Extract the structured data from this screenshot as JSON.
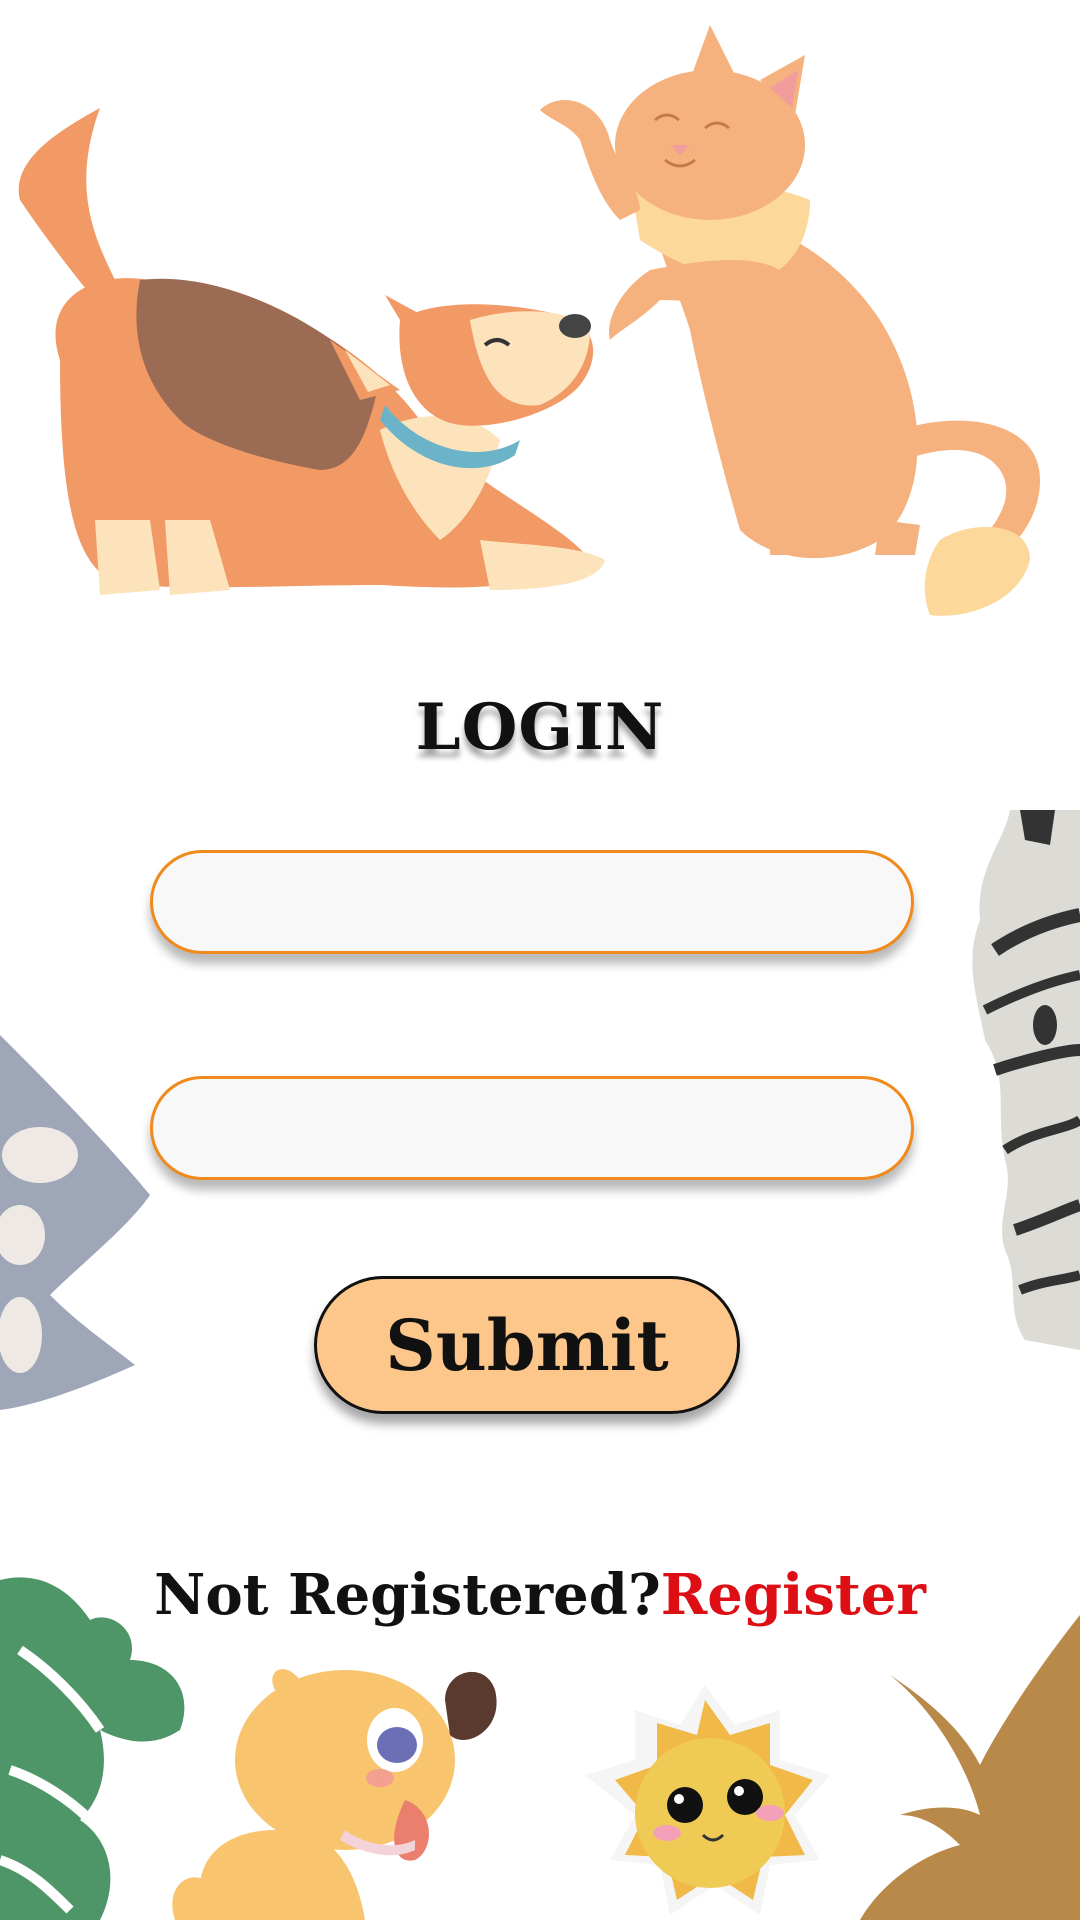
{
  "page": {
    "title": "LOGIN"
  },
  "form": {
    "field1": {
      "value": "",
      "placeholder": ""
    },
    "field2": {
      "value": "",
      "placeholder": ""
    },
    "submit_label": "Submit"
  },
  "footer": {
    "prompt": "Not Registered?",
    "link": "Register"
  },
  "colors": {
    "field_border": "#f08a1c",
    "button_bg": "#fdc68a",
    "link": "#dd0f14"
  },
  "illustrations": [
    "dog-illustration",
    "cat-illustration",
    "zebra-paper-decoration",
    "slate-leaf-decoration",
    "green-leaf-decoration",
    "puppy-sticker",
    "sun-sticker",
    "brown-plant-decoration"
  ]
}
